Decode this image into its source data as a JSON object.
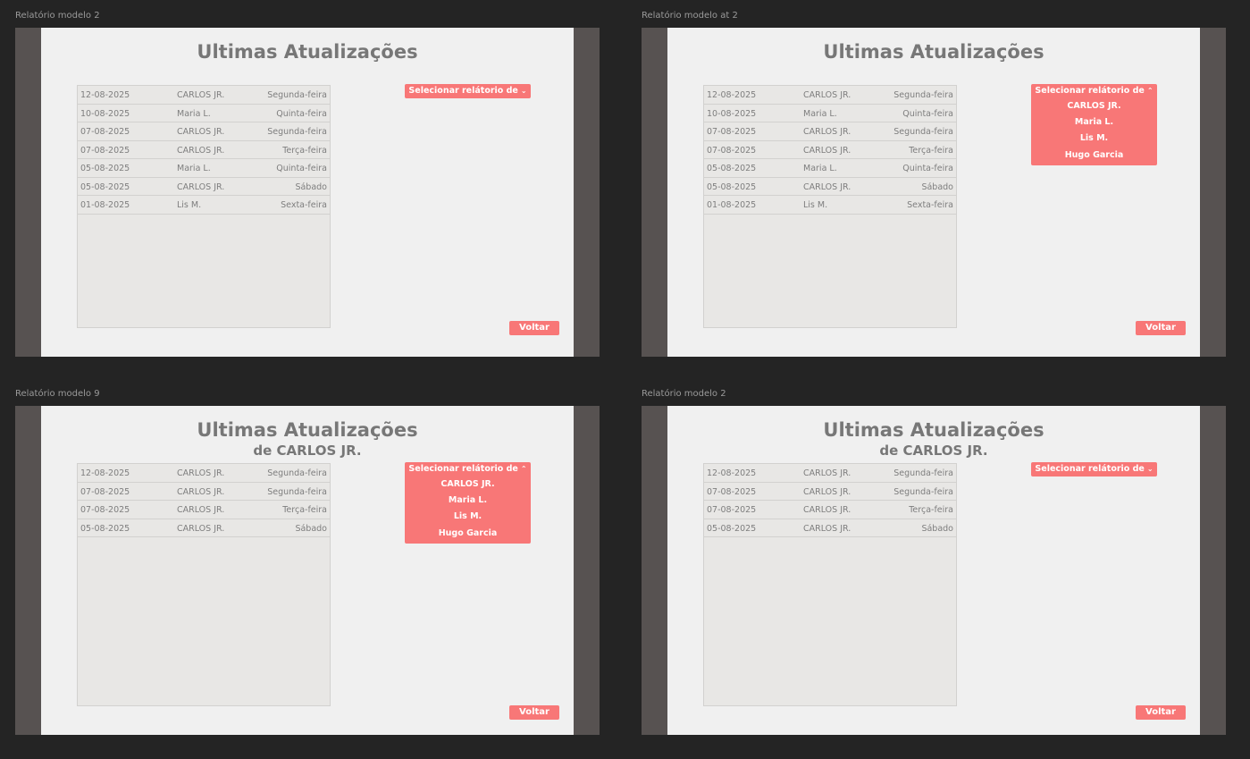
{
  "frames": [
    {
      "label": "Relatório modelo 2",
      "title": "Ultimas Atualizações",
      "subtitle": "",
      "dropdown": {
        "label": "Selecionar relátorio de",
        "chevron": "⌄",
        "expanded": false,
        "options": []
      },
      "rows": [
        {
          "date": "12-08-2025",
          "name": "CARLOS JR.",
          "day": "Segunda-feira"
        },
        {
          "date": "10-08-2025",
          "name": "Maria L.",
          "day": "Quinta-feira"
        },
        {
          "date": "07-08-2025",
          "name": "CARLOS JR.",
          "day": "Segunda-feira"
        },
        {
          "date": "07-08-2025",
          "name": "CARLOS JR.",
          "day": "Terça-feira"
        },
        {
          "date": "05-08-2025",
          "name": "Maria L.",
          "day": "Quinta-feira"
        },
        {
          "date": "05-08-2025",
          "name": "CARLOS JR.",
          "day": "Sábado"
        },
        {
          "date": "01-08-2025",
          "name": "Lis M.",
          "day": "Sexta-feira"
        }
      ],
      "back_label": "Voltar"
    },
    {
      "label": "Relatório modelo at 2",
      "title": "Ultimas Atualizações",
      "subtitle": "",
      "dropdown": {
        "label": "Selecionar relátorio de",
        "chevron": "⌃",
        "expanded": true,
        "options": [
          "CARLOS JR.",
          "Maria L.",
          "Lis M.",
          "Hugo Garcia"
        ]
      },
      "rows": [
        {
          "date": "12-08-2025",
          "name": "CARLOS JR.",
          "day": "Segunda-feira"
        },
        {
          "date": "10-08-2025",
          "name": "Maria L.",
          "day": "Quinta-feira"
        },
        {
          "date": "07-08-2025",
          "name": "CARLOS JR.",
          "day": "Segunda-feira"
        },
        {
          "date": "07-08-2025",
          "name": "CARLOS JR.",
          "day": "Terça-feira"
        },
        {
          "date": "05-08-2025",
          "name": "Maria L.",
          "day": "Quinta-feira"
        },
        {
          "date": "05-08-2025",
          "name": "CARLOS JR.",
          "day": "Sábado"
        },
        {
          "date": "01-08-2025",
          "name": "Lis M.",
          "day": "Sexta-feira"
        }
      ],
      "back_label": "Voltar"
    },
    {
      "label": "Relatório modelo 9",
      "title": "Ultimas Atualizações",
      "subtitle": "de CARLOS JR.",
      "dropdown": {
        "label": "Selecionar relátorio de",
        "chevron": "⌃",
        "expanded": true,
        "options": [
          "CARLOS JR.",
          "Maria L.",
          "Lis M.",
          "Hugo Garcia"
        ]
      },
      "rows": [
        {
          "date": "12-08-2025",
          "name": "CARLOS JR.",
          "day": "Segunda-feira"
        },
        {
          "date": "07-08-2025",
          "name": "CARLOS JR.",
          "day": "Segunda-feira"
        },
        {
          "date": "07-08-2025",
          "name": "CARLOS JR.",
          "day": "Terça-feira"
        },
        {
          "date": "05-08-2025",
          "name": "CARLOS JR.",
          "day": "Sábado"
        }
      ],
      "back_label": "Voltar"
    },
    {
      "label": "Relatório modelo 2",
      "title": "Ultimas Atualizações",
      "subtitle": "de CARLOS JR.",
      "dropdown": {
        "label": "Selecionar relátorio de",
        "chevron": "⌄",
        "expanded": false,
        "options": []
      },
      "rows": [
        {
          "date": "12-08-2025",
          "name": "CARLOS JR.",
          "day": "Segunda-feira"
        },
        {
          "date": "07-08-2025",
          "name": "CARLOS JR.",
          "day": "Segunda-feira"
        },
        {
          "date": "07-08-2025",
          "name": "CARLOS JR.",
          "day": "Terça-feira"
        },
        {
          "date": "05-08-2025",
          "name": "CARLOS JR.",
          "day": "Sábado"
        }
      ],
      "back_label": "Voltar"
    }
  ]
}
